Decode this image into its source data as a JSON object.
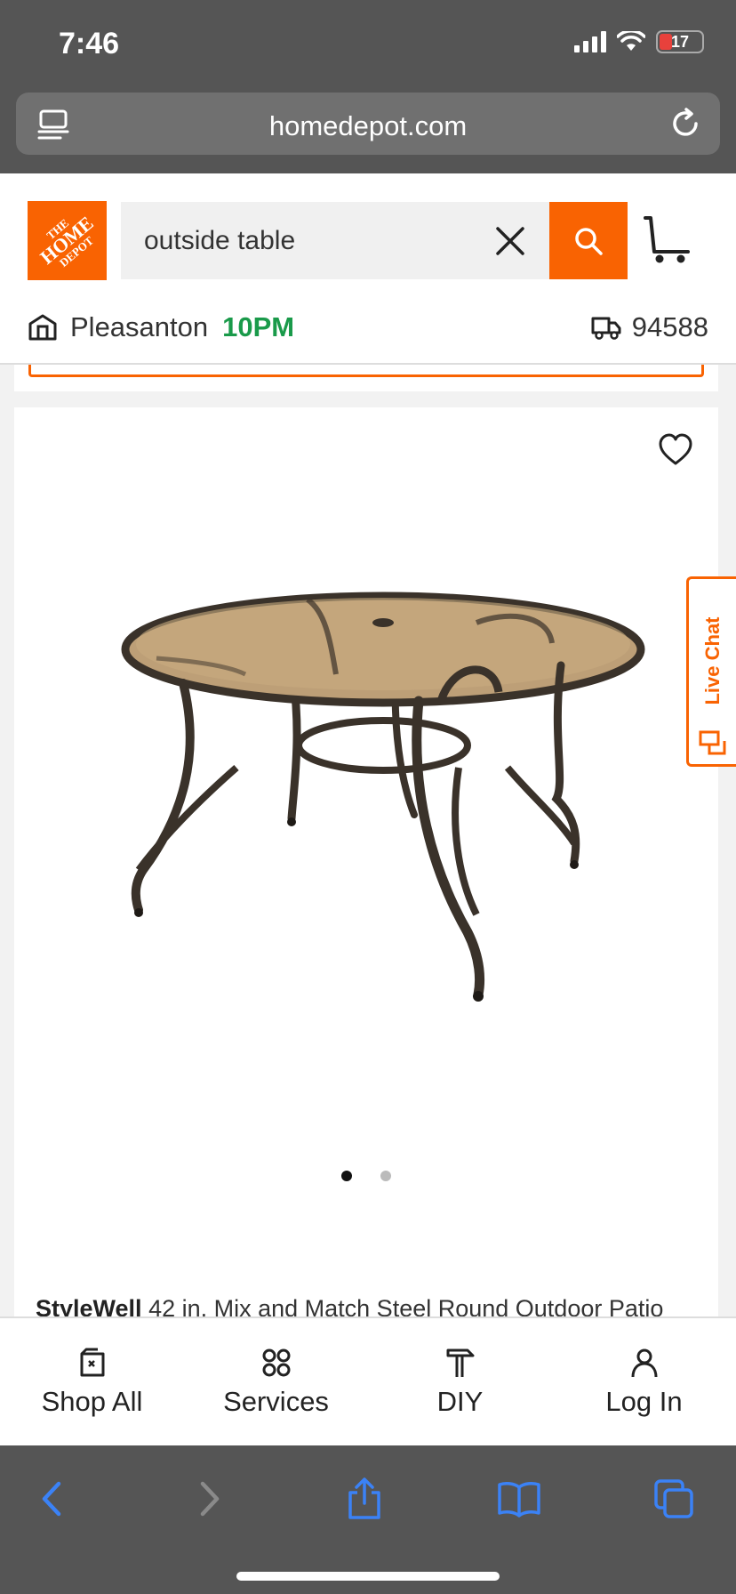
{
  "status_bar": {
    "time": "7:46",
    "battery_level": "17"
  },
  "browser": {
    "url": "homedepot.com"
  },
  "header": {
    "logo_text": [
      "THE",
      "HOME",
      "DEPOT"
    ],
    "search_value": "outside table",
    "store_name": "Pleasanton",
    "store_hours": "10PM",
    "zip": "94588"
  },
  "product": {
    "brand": "StyleWell",
    "title": " 42 in. Mix and Match Steel Round Outdoor Patio",
    "image_count": 2,
    "active_image": 1
  },
  "live_chat": {
    "label": "Live Chat"
  },
  "bottom_nav": {
    "items": [
      {
        "label": "Shop All",
        "icon": "shop-all-icon"
      },
      {
        "label": "Services",
        "icon": "services-icon"
      },
      {
        "label": "DIY",
        "icon": "diy-hammer-icon"
      },
      {
        "label": "Log In",
        "icon": "user-icon"
      }
    ]
  },
  "colors": {
    "brand_orange": "#f96302",
    "open_green": "#1a9a4a",
    "safari_blue": "#3b82f6"
  }
}
